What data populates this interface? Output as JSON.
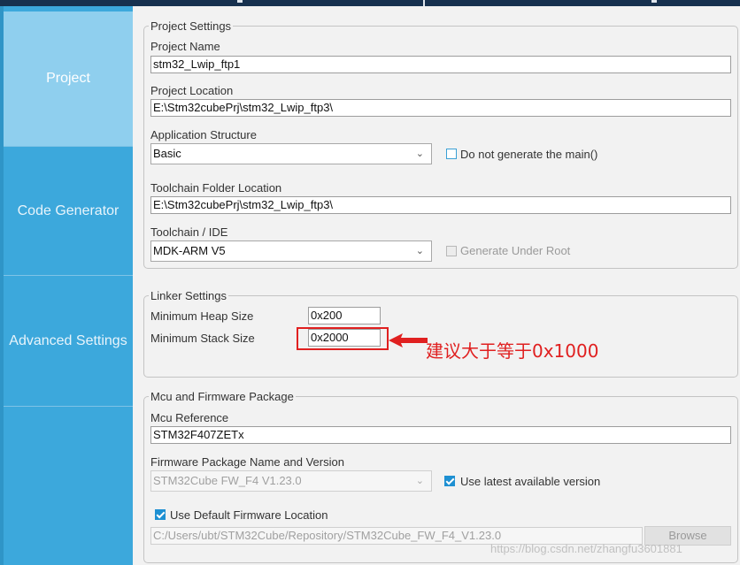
{
  "sidebar": {
    "items": [
      {
        "label": "Project"
      },
      {
        "label": "Code Generator"
      },
      {
        "label": "Advanced Settings"
      }
    ]
  },
  "project_settings": {
    "legend": "Project Settings",
    "name_label": "Project Name",
    "name_value": "stm32_Lwip_ftp1",
    "location_label": "Project Location",
    "location_value": "E:\\Stm32cubePrj\\stm32_Lwip_ftp3\\",
    "structure_label": "Application Structure",
    "structure_value": "Basic",
    "no_main_label": "Do not generate the main()",
    "toolchain_folder_label": "Toolchain Folder Location",
    "toolchain_folder_value": "E:\\Stm32cubePrj\\stm32_Lwip_ftp3\\",
    "toolchain_label": "Toolchain / IDE",
    "toolchain_value": "MDK-ARM V5",
    "under_root_label": "Generate Under Root"
  },
  "linker_settings": {
    "legend": "Linker Settings",
    "heap_label": "Minimum Heap Size",
    "heap_value": "0x200",
    "stack_label": "Minimum Stack Size",
    "stack_value": "0x2000"
  },
  "mcu_package": {
    "legend": "Mcu and Firmware Package",
    "mcu_ref_label": "Mcu Reference",
    "mcu_ref_value": "STM32F407ZETx",
    "fw_label": "Firmware Package Name and Version",
    "fw_value": "STM32Cube FW_F4 V1.23.0",
    "use_latest_label": "Use latest available version",
    "use_default_label": "Use Default Firmware Location",
    "fw_location_value": "C:/Users/ubt/STM32Cube/Repository/STM32Cube_FW_F4_V1.23.0",
    "browse_label": "Browse"
  },
  "annotation": {
    "text": "建议大于等于0x1000",
    "color": "#e02020"
  },
  "watermark": "https://blog.csdn.net/zhangfu3601881",
  "colors": {
    "sidebar": "#3ca8dc",
    "sidebar_active": "#8fcfee",
    "checkbox_checked": "#1e90d2",
    "topbar": "#17314f"
  }
}
